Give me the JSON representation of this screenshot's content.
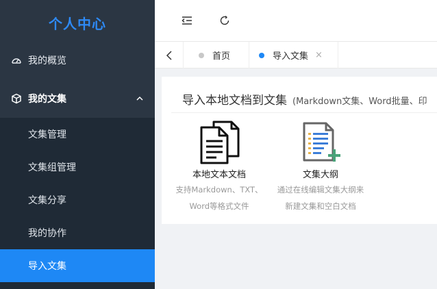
{
  "sidebar": {
    "brand": "个人中心",
    "overview_label": "我的概览",
    "collection_label": "我的文集",
    "items": [
      {
        "label": "文集管理"
      },
      {
        "label": "文集组管理"
      },
      {
        "label": "文集分享"
      },
      {
        "label": "我的协作"
      },
      {
        "label": "导入文集"
      }
    ],
    "active_index": 4,
    "colors": {
      "bg": "#2b3643",
      "sub_bg": "#1f2a36",
      "active": "#1e88f5",
      "brand": "#2e8af6"
    }
  },
  "topbar": {
    "collapse_icon": "indent-icon",
    "refresh_icon": "refresh-icon"
  },
  "tabs": {
    "back_icon": "chevron-left-icon",
    "items": [
      {
        "label": "首页",
        "active": false
      },
      {
        "label": "导入文集",
        "active": true,
        "closable": true
      }
    ],
    "close_symbol": "×"
  },
  "main": {
    "title": "导入本地文档到文集",
    "subtitle": "(Markdown文集、Word批量、印",
    "options": [
      {
        "name": "本地文本文档",
        "desc1": "支持Markdown、TXT、",
        "desc2": "Word等格式文件",
        "icon": "documents-icon"
      },
      {
        "name": "文集大纲",
        "desc1": "通过在线编辑文集大纲来",
        "desc2": "新建文集和空白文档",
        "icon": "outline-add-icon"
      }
    ]
  }
}
